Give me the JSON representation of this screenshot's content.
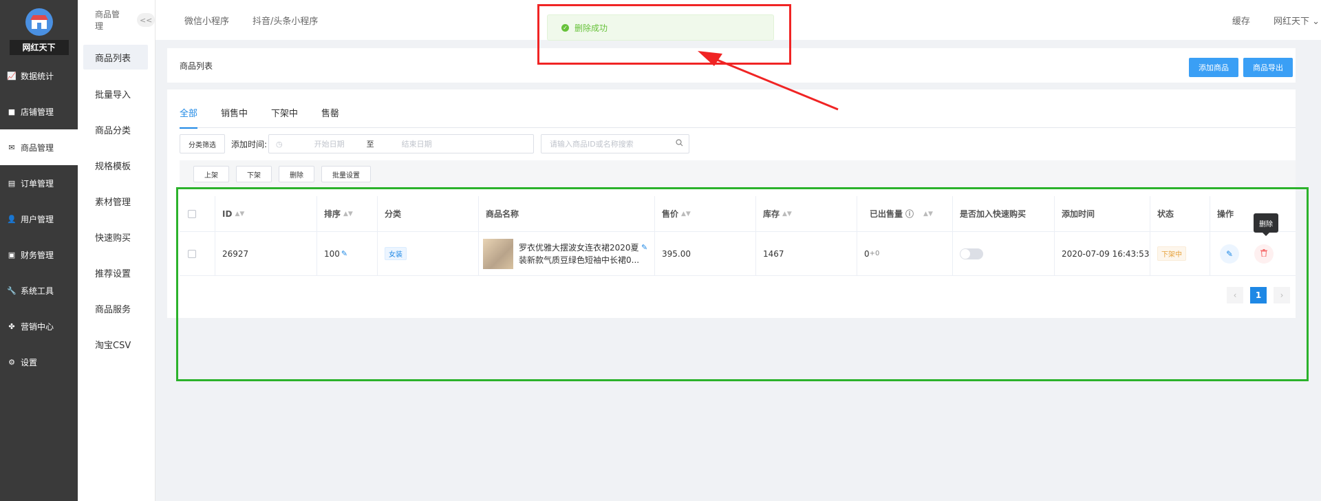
{
  "sidebar": {
    "brand_name": "网红天下",
    "items": [
      {
        "label": "数据统计",
        "icon": "chart-icon"
      },
      {
        "label": "店铺管理",
        "icon": "shop-icon"
      },
      {
        "label": "商品管理",
        "icon": "goods-icon"
      },
      {
        "label": "订单管理",
        "icon": "order-icon"
      },
      {
        "label": "用户管理",
        "icon": "user-icon"
      },
      {
        "label": "财务管理",
        "icon": "finance-icon"
      },
      {
        "label": "系统工具",
        "icon": "wrench-icon"
      },
      {
        "label": "营销中心",
        "icon": "marketing-icon"
      },
      {
        "label": "设置",
        "icon": "gear-icon"
      }
    ]
  },
  "submenu": {
    "title": "商品管理",
    "collapse_label": "<<",
    "items": [
      "商品列表",
      "批量导入",
      "商品分类",
      "规格模板",
      "素材管理",
      "快速购买",
      "推荐设置",
      "商品服务",
      "淘宝CSV"
    ]
  },
  "topbar": {
    "tabs": [
      "微信小程序",
      "抖音/头条小程序"
    ],
    "cache_label": "缓存",
    "user_label": "网红天下"
  },
  "toast": {
    "message": "删除成功",
    "color": "#67c23a"
  },
  "page_header": {
    "title": "商品列表",
    "add_button": "添加商品",
    "export_button": "商品导出"
  },
  "tabs": [
    "全部",
    "销售中",
    "下架中",
    "售罄"
  ],
  "filters": {
    "category_button": "分类筛选",
    "time_label": "添加时间:",
    "start_placeholder": "开始日期",
    "range_separator": "至",
    "end_placeholder": "结束日期",
    "search_placeholder": "请输入商品ID或名称搜索"
  },
  "actions": [
    "上架",
    "下架",
    "删除",
    "批量设置"
  ],
  "table": {
    "headers": {
      "id": "ID",
      "sort": "排序",
      "category": "分类",
      "name": "商品名称",
      "price": "售价",
      "stock": "库存",
      "sold": "已出售量",
      "quick_buy": "是否加入快速购买",
      "added": "添加时间",
      "status": "状态",
      "ops": "操作"
    },
    "rows": [
      {
        "id": "26927",
        "sort": "100",
        "category": "女装",
        "name": "罗衣优雅大摆波女连衣裙2020夏装新款气质豆绿色短袖中长裙0...",
        "price": "395.00",
        "stock": "1467",
        "sold_base": "0",
        "sold_extra": "+0",
        "added": "2020-07-09 16:43:53",
        "status": "下架中"
      }
    ]
  },
  "tooltip": "删除",
  "pager": {
    "current": "1"
  },
  "colors": {
    "primary": "#3a9ff5",
    "annotation_red": "#f02424",
    "annotation_green": "#2bb22b"
  }
}
